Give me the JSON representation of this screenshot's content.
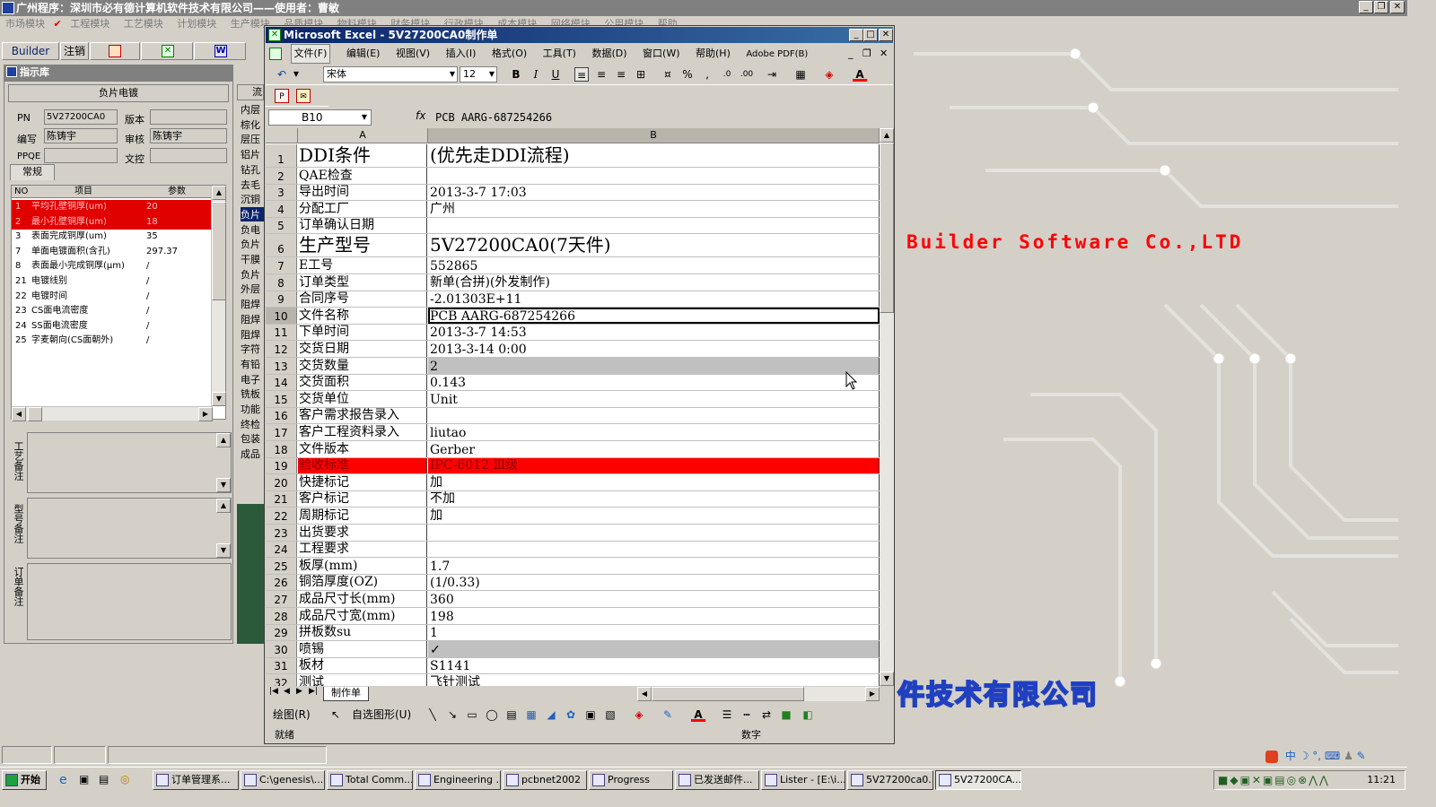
{
  "app": {
    "title": "广州程序：深圳市必有德计算机软件技术有限公司——使用者：曹敏",
    "menu": [
      "市场模块",
      "工程模块",
      "工艺模块",
      "计划模块",
      "生产模块",
      "品质模块",
      "物料模块",
      "财务模块",
      "行政模块",
      "成本模块",
      "网络模块",
      "公用模块",
      "帮助"
    ],
    "toolbar": {
      "builder": "Builder",
      "logout": "注销"
    }
  },
  "left_panel": {
    "header": "指示库",
    "subheader": "负片电镀",
    "fields": {
      "pn_label": "PN",
      "pn_value": "5V27200CA0",
      "version_label": "版本",
      "version_value": "",
      "editor_label": "编写",
      "editor_value": "陈铸宇",
      "reviewer_label": "审核",
      "reviewer_value": "陈铸宇",
      "ppqe_label": "PPQE",
      "ppqe_value": "",
      "doc_label": "文控",
      "doc_value": ""
    },
    "tab": "常规",
    "grid_headers": {
      "no": "NO",
      "item": "项目",
      "param": "参数"
    },
    "rows": [
      {
        "no": "1",
        "item": "平均孔壁铜厚(um)",
        "param": "20",
        "highlight": true
      },
      {
        "no": "2",
        "item": "最小孔壁铜厚(um)",
        "param": "18",
        "highlight": true
      },
      {
        "no": "3",
        "item": "表面完成铜厚(um)",
        "param": "35",
        "highlight": false
      },
      {
        "no": "7",
        "item": "单面电镀面积(含孔)",
        "param": "297.37",
        "highlight": false
      },
      {
        "no": "8",
        "item": "表面最小完成铜厚(μm)",
        "param": "/",
        "highlight": false
      },
      {
        "no": "21",
        "item": "电镀线别",
        "param": "/",
        "highlight": false
      },
      {
        "no": "22",
        "item": "电镀时间",
        "param": "/",
        "highlight": false
      },
      {
        "no": "23",
        "item": "CS面电流密度",
        "param": "/",
        "highlight": false
      },
      {
        "no": "24",
        "item": "SS面电流密度",
        "param": "/",
        "highlight": false
      },
      {
        "no": "25",
        "item": "字麦朝向(CS面朝外)",
        "param": "/",
        "highlight": false
      }
    ],
    "notes": {
      "craft": "工艺备注",
      "model": "型号备注",
      "order": "订单备注"
    }
  },
  "mid_strip": {
    "header": "流",
    "items": [
      "内层",
      "棕化",
      "层压",
      "铝片",
      "钻孔",
      "去毛",
      "沉铜",
      "负片",
      "负电",
      "负片",
      "干膜",
      "负片",
      "外层",
      "阻焊",
      "阻焊",
      "阻焊",
      "字符",
      "有铅",
      "电子",
      "铣板",
      "功能",
      "终检",
      "包装",
      "成品"
    ]
  },
  "excel": {
    "title": "Microsoft Excel - 5V27200CA0制作单",
    "menu": [
      "文件(F)",
      "编辑(E)",
      "视图(V)",
      "插入(I)",
      "格式(O)",
      "工具(T)",
      "数据(D)",
      "窗口(W)",
      "帮助(H)",
      "Adobe PDF(B)"
    ],
    "font_name": "宋体",
    "font_size": "12",
    "name_box": "B10",
    "fx": "fx",
    "formula": "PCB AARG-687254266",
    "col_a": "A",
    "col_b": "B",
    "rows": [
      {
        "n": "1",
        "a": "DDI条件",
        "b": "(优先走DDI流程)",
        "style": "big"
      },
      {
        "n": "2",
        "a": "QAE检查",
        "b": "",
        "style": ""
      },
      {
        "n": "3",
        "a": "导出时间",
        "b": "2013-3-7 17:03",
        "style": ""
      },
      {
        "n": "4",
        "a": "分配工厂",
        "b": "广州",
        "style": ""
      },
      {
        "n": "5",
        "a": "订单确认日期",
        "b": "",
        "style": ""
      },
      {
        "n": "6",
        "a": "生产型号",
        "b": "5V27200CA0(7天件)",
        "style": "big"
      },
      {
        "n": "7",
        "a": "E工号",
        "b": "552865",
        "style": ""
      },
      {
        "n": "8",
        "a": "订单类型",
        "b": "新单(合拼)(外发制作)",
        "style": ""
      },
      {
        "n": "9",
        "a": "合同序号",
        "b": "-2.01303E+11",
        "style": ""
      },
      {
        "n": "10",
        "a": "文件名称",
        "b": "PCB AARG-687254266",
        "style": "sel"
      },
      {
        "n": "11",
        "a": "下单时间",
        "b": "2013-3-7 14:53",
        "style": ""
      },
      {
        "n": "12",
        "a": "交货日期",
        "b": "2013-3-14 0:00",
        "style": ""
      },
      {
        "n": "13",
        "a": "交货数量",
        "b": "2",
        "style": "gray"
      },
      {
        "n": "14",
        "a": "交货面积",
        "b": "0.143",
        "style": ""
      },
      {
        "n": "15",
        "a": "交货单位",
        "b": "Unit",
        "style": ""
      },
      {
        "n": "16",
        "a": "客户需求报告录入",
        "b": "",
        "style": ""
      },
      {
        "n": "17",
        "a": "客户工程资料录入",
        "b": "liutao",
        "style": ""
      },
      {
        "n": "18",
        "a": "文件版本",
        "b": "Gerber",
        "style": ""
      },
      {
        "n": "19",
        "a": "验收标准",
        "b": "IPC-6012 Ⅲ级",
        "style": "red"
      },
      {
        "n": "20",
        "a": "快捷标记",
        "b": "加",
        "style": ""
      },
      {
        "n": "21",
        "a": "客户标记",
        "b": "不加",
        "style": ""
      },
      {
        "n": "22",
        "a": "周期标记",
        "b": "加",
        "style": ""
      },
      {
        "n": "23",
        "a": "出货要求",
        "b": "",
        "style": ""
      },
      {
        "n": "24",
        "a": "工程要求",
        "b": "",
        "style": ""
      },
      {
        "n": "25",
        "a": "板厚(mm)",
        "b": "1.7",
        "style": ""
      },
      {
        "n": "26",
        "a": "铜箔厚度(OZ)",
        "b": "(1/0.33)",
        "style": ""
      },
      {
        "n": "27",
        "a": "成品尺寸长(mm)",
        "b": "360",
        "style": ""
      },
      {
        "n": "28",
        "a": "成品尺寸宽(mm)",
        "b": "198",
        "style": ""
      },
      {
        "n": "29",
        "a": "拼板数su",
        "b": "1",
        "style": ""
      },
      {
        "n": "30",
        "a": "喷锡",
        "b": "✓",
        "style": "gray"
      },
      {
        "n": "31",
        "a": "板材",
        "b": "S1141",
        "style": ""
      },
      {
        "n": "32",
        "a": "测试",
        "b": "飞针测试",
        "style": ""
      }
    ],
    "sheet_tab": "制作单",
    "draw_label": "绘图(R)",
    "autoshape_label": "自选图形(U)",
    "status_ready": "就绪",
    "status_num": "数字"
  },
  "deco": {
    "company_en": "Builder Software Co.,LTD",
    "company_cn": "件技术有限公司"
  },
  "taskbar": {
    "start": "开始",
    "tasks": [
      "订单管理系...",
      "C:\\genesis\\...",
      "Total Comm...",
      "Engineering ...",
      "pcbnet2002",
      "Progress",
      "已发送邮件...",
      "Lister - [E:\\i...",
      "5V27200ca0...",
      "5V27200CA..."
    ],
    "clock": "11:21",
    "ime": "中"
  },
  "colors": {
    "accent_red": "#ff0000",
    "title_blue": "#0a246a",
    "deco_blue": "#2040c0"
  }
}
